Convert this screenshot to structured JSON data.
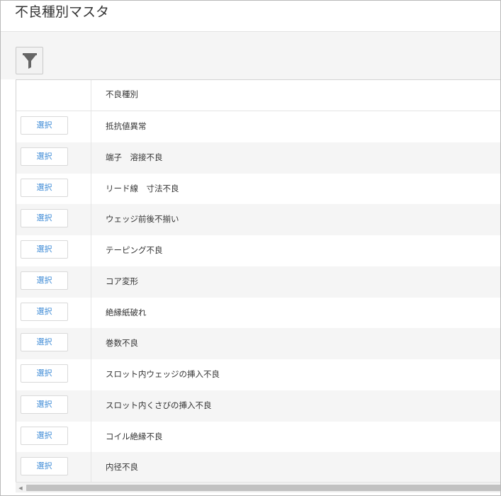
{
  "page": {
    "title": "不良種別マスタ"
  },
  "toolbar": {
    "filter_icon": "filter-funnel-icon"
  },
  "grid": {
    "columns": [
      {
        "key": "select",
        "label": ""
      },
      {
        "key": "defect_type",
        "label": "不良種別"
      }
    ],
    "select_label": "選択",
    "rows": [
      {
        "defect_type": "抵抗値異常"
      },
      {
        "defect_type": "端子　溶接不良"
      },
      {
        "defect_type": "リード線　寸法不良"
      },
      {
        "defect_type": "ウェッジ前後不揃い"
      },
      {
        "defect_type": "テーピング不良"
      },
      {
        "defect_type": "コア変形"
      },
      {
        "defect_type": "絶縁紙破れ"
      },
      {
        "defect_type": "巻数不良"
      },
      {
        "defect_type": "スロット内ウェッジの挿入不良"
      },
      {
        "defect_type": "スロット内くさびの挿入不良"
      },
      {
        "defect_type": "コイル絶縁不良"
      },
      {
        "defect_type": "内径不良"
      }
    ]
  },
  "scrollbar": {
    "left_arrow_icon": "scroll-left-arrow-icon"
  },
  "colors": {
    "select_text": "#3c8ad6",
    "row_alt_background": "#f5f5f5",
    "toolbar_background": "#f5f5f5",
    "scroll_thumb": "#c1c1c1"
  }
}
